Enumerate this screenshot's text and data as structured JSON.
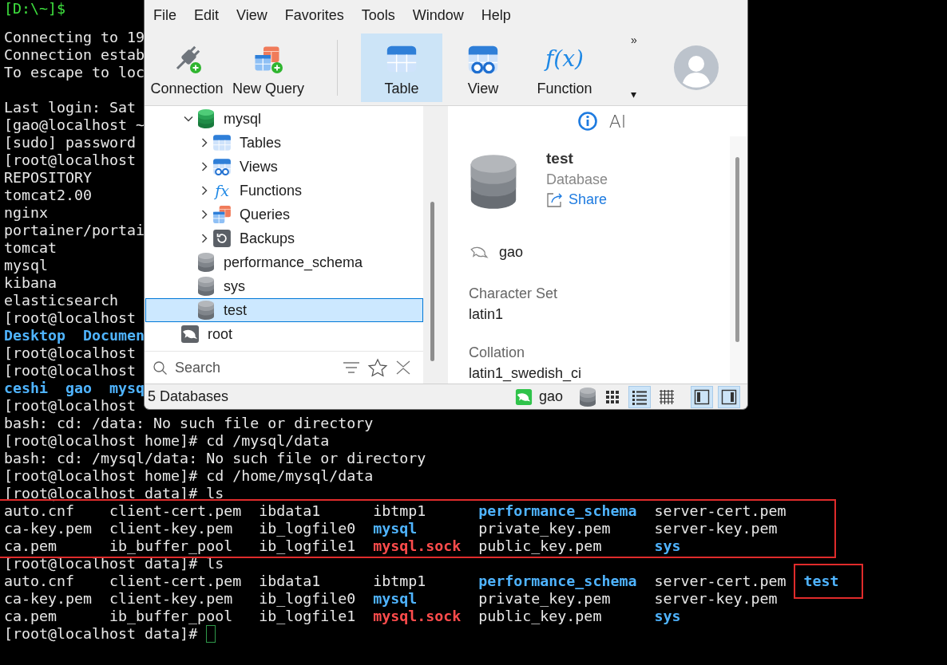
{
  "terminal": {
    "lines": [
      {
        "kind": "host",
        "text": "[D:\\~]$"
      },
      {
        "kind": "blank"
      },
      {
        "kind": "text",
        "text": "Connecting to 19"
      },
      {
        "kind": "text",
        "text": "Connection estab"
      },
      {
        "kind": "text",
        "text": "To escape to loc"
      },
      {
        "kind": "blank"
      },
      {
        "kind": "text",
        "text": "Last login: Sat"
      },
      {
        "kind": "text",
        "text": "[gao@localhost ~"
      },
      {
        "kind": "text",
        "text": "[sudo] password"
      },
      {
        "kind": "text",
        "text": "[root@localhost"
      },
      {
        "kind": "text",
        "text": "REPOSITORY"
      },
      {
        "kind": "text",
        "text": "tomcat2.00"
      },
      {
        "kind": "text",
        "text": "nginx"
      },
      {
        "kind": "text",
        "text": "portainer/portai"
      },
      {
        "kind": "text",
        "text": "tomcat"
      },
      {
        "kind": "text",
        "text": "mysql"
      },
      {
        "kind": "text",
        "text": "kibana"
      },
      {
        "kind": "text",
        "text": "elasticsearch"
      },
      {
        "kind": "text",
        "text": "[root@localhost"
      },
      {
        "kind": "dirs",
        "text": "Desktop  Documen"
      },
      {
        "kind": "text",
        "text": "[root@localhost"
      },
      {
        "kind": "text",
        "text": "[root@localhost"
      },
      {
        "kind": "dirs",
        "text": "ceshi  gao  mysq"
      },
      {
        "kind": "text",
        "text": "[root@localhost"
      },
      {
        "kind": "text",
        "text": "bash: cd: /data: No such file or directory"
      },
      {
        "kind": "text",
        "text": "[root@localhost home]# cd /mysql/data"
      },
      {
        "kind": "text",
        "text": "bash: cd: /mysql/data: No such file or directory"
      },
      {
        "kind": "text",
        "text": "[root@localhost home]# cd /home/mysql/data"
      },
      {
        "kind": "text",
        "text": "[root@localhost data]# ls"
      },
      {
        "kind": "listing",
        "highlighted": true,
        "rows": [
          [
            {
              "text": "auto.cnf",
              "kind": "file",
              "highlighted": false
            },
            {
              "text": "client-cert.pem",
              "kind": "file",
              "highlighted": false
            },
            {
              "text": "ibdata1",
              "kind": "file",
              "highlighted": false
            },
            {
              "text": "ibtmp1",
              "kind": "file",
              "highlighted": false
            },
            {
              "text": "performance_schema",
              "kind": "dir",
              "highlighted": false
            },
            {
              "text": "server-cert.pem",
              "kind": "file",
              "highlighted": false
            }
          ],
          [
            {
              "text": "ca-key.pem",
              "kind": "file",
              "highlighted": false
            },
            {
              "text": "client-key.pem",
              "kind": "file",
              "highlighted": false
            },
            {
              "text": "ib_logfile0",
              "kind": "file",
              "highlighted": false
            },
            {
              "text": "mysql",
              "kind": "dir",
              "highlighted": false
            },
            {
              "text": "private_key.pem",
              "kind": "file",
              "highlighted": false
            },
            {
              "text": "server-key.pem",
              "kind": "file",
              "highlighted": false
            }
          ],
          [
            {
              "text": "ca.pem",
              "kind": "file",
              "highlighted": false
            },
            {
              "text": "ib_buffer_pool",
              "kind": "file",
              "highlighted": false
            },
            {
              "text": "ib_logfile1",
              "kind": "file",
              "highlighted": false
            },
            {
              "text": "mysql.sock",
              "kind": "socket",
              "highlighted": false
            },
            {
              "text": "public_key.pem",
              "kind": "file",
              "highlighted": false
            },
            {
              "text": "sys",
              "kind": "dir",
              "highlighted": false
            }
          ]
        ]
      },
      {
        "kind": "text",
        "text": "[root@localhost data]# ls"
      },
      {
        "kind": "listing",
        "highlighted": false,
        "rows": [
          [
            {
              "text": "auto.cnf",
              "kind": "file",
              "highlighted": false
            },
            {
              "text": "client-cert.pem",
              "kind": "file",
              "highlighted": false
            },
            {
              "text": "ibdata1",
              "kind": "file",
              "highlighted": false
            },
            {
              "text": "ibtmp1",
              "kind": "file",
              "highlighted": false
            },
            {
              "text": "performance_schema",
              "kind": "dir",
              "highlighted": false
            },
            {
              "text": "server-cert.pem",
              "kind": "file",
              "highlighted": false
            },
            {
              "text": "test",
              "kind": "dir",
              "highlighted": true
            }
          ],
          [
            {
              "text": "ca-key.pem",
              "kind": "file",
              "highlighted": false
            },
            {
              "text": "client-key.pem",
              "kind": "file",
              "highlighted": false
            },
            {
              "text": "ib_logfile0",
              "kind": "file",
              "highlighted": false
            },
            {
              "text": "mysql",
              "kind": "dir",
              "highlighted": false
            },
            {
              "text": "private_key.pem",
              "kind": "file",
              "highlighted": false
            },
            {
              "text": "server-key.pem",
              "kind": "file",
              "highlighted": false
            }
          ],
          [
            {
              "text": "ca.pem",
              "kind": "file",
              "highlighted": false
            },
            {
              "text": "ib_buffer_pool",
              "kind": "file",
              "highlighted": false
            },
            {
              "text": "ib_logfile1",
              "kind": "file",
              "highlighted": false
            },
            {
              "text": "mysql.sock",
              "kind": "socket",
              "highlighted": false
            },
            {
              "text": "public_key.pem",
              "kind": "file",
              "highlighted": false
            },
            {
              "text": "sys",
              "kind": "dir",
              "highlighted": false
            }
          ]
        ]
      },
      {
        "kind": "prompt",
        "text": "[root@localhost data]#",
        "cursor": true
      }
    ]
  },
  "app_window": {
    "menu": [
      "File",
      "Edit",
      "View",
      "Favorites",
      "Tools",
      "Window",
      "Help"
    ],
    "toolbar": [
      {
        "kind": "connection",
        "label": "Connection",
        "selected": false
      },
      {
        "kind": "new-query",
        "label": "New Query",
        "selected": false
      },
      {
        "kind": "table",
        "label": "Table",
        "selected": true
      },
      {
        "kind": "view",
        "label": "View",
        "selected": false
      },
      {
        "kind": "function",
        "label": "Function",
        "glyph": "f(x)",
        "selected": false
      }
    ],
    "overflow": "»",
    "dropdown": "▾",
    "tree": [
      {
        "kind": "offscreen-group",
        "children": [
          {
            "kind": "database-open",
            "label": "mysql",
            "expanded": true,
            "selected": false,
            "children": [
              {
                "kind": "tables",
                "label": "Tables",
                "expanded": false,
                "selected": false
              },
              {
                "kind": "views",
                "label": "Views",
                "expanded": false,
                "selected": false
              },
              {
                "kind": "functions",
                "label": "Functions",
                "glyph": "fx",
                "expanded": false,
                "selected": false
              },
              {
                "kind": "queries",
                "label": "Queries",
                "expanded": false,
                "selected": false
              },
              {
                "kind": "backups",
                "label": "Backups",
                "expanded": false,
                "selected": false
              }
            ]
          },
          {
            "kind": "database",
            "label": "performance_schema",
            "selected": false
          },
          {
            "kind": "database",
            "label": "sys",
            "selected": false
          },
          {
            "kind": "database",
            "label": "test",
            "selected": true
          }
        ]
      },
      {
        "kind": "connection",
        "label": "root",
        "selected": false
      }
    ],
    "search": {
      "placeholder": "Search"
    },
    "detail_tabs": [
      {
        "kind": "info",
        "selected": true
      },
      {
        "kind": "ai",
        "label": "AI",
        "selected": false
      }
    ],
    "details": {
      "name": "test",
      "type": "Database",
      "share": "Share",
      "owner": "gao",
      "fields": [
        {
          "label": "Character Set",
          "value": "latin1"
        },
        {
          "label": "Collation",
          "value": "latin1_swedish_ci"
        }
      ]
    },
    "status": {
      "text": "5 Databases",
      "connection": "gao",
      "view_modes": [
        {
          "kind": "icons",
          "selected": false
        },
        {
          "kind": "list",
          "selected": true
        },
        {
          "kind": "grid",
          "selected": false
        }
      ],
      "pane_toggles": [
        {
          "kind": "left",
          "selected": true
        },
        {
          "kind": "right",
          "selected": true
        }
      ]
    }
  }
}
